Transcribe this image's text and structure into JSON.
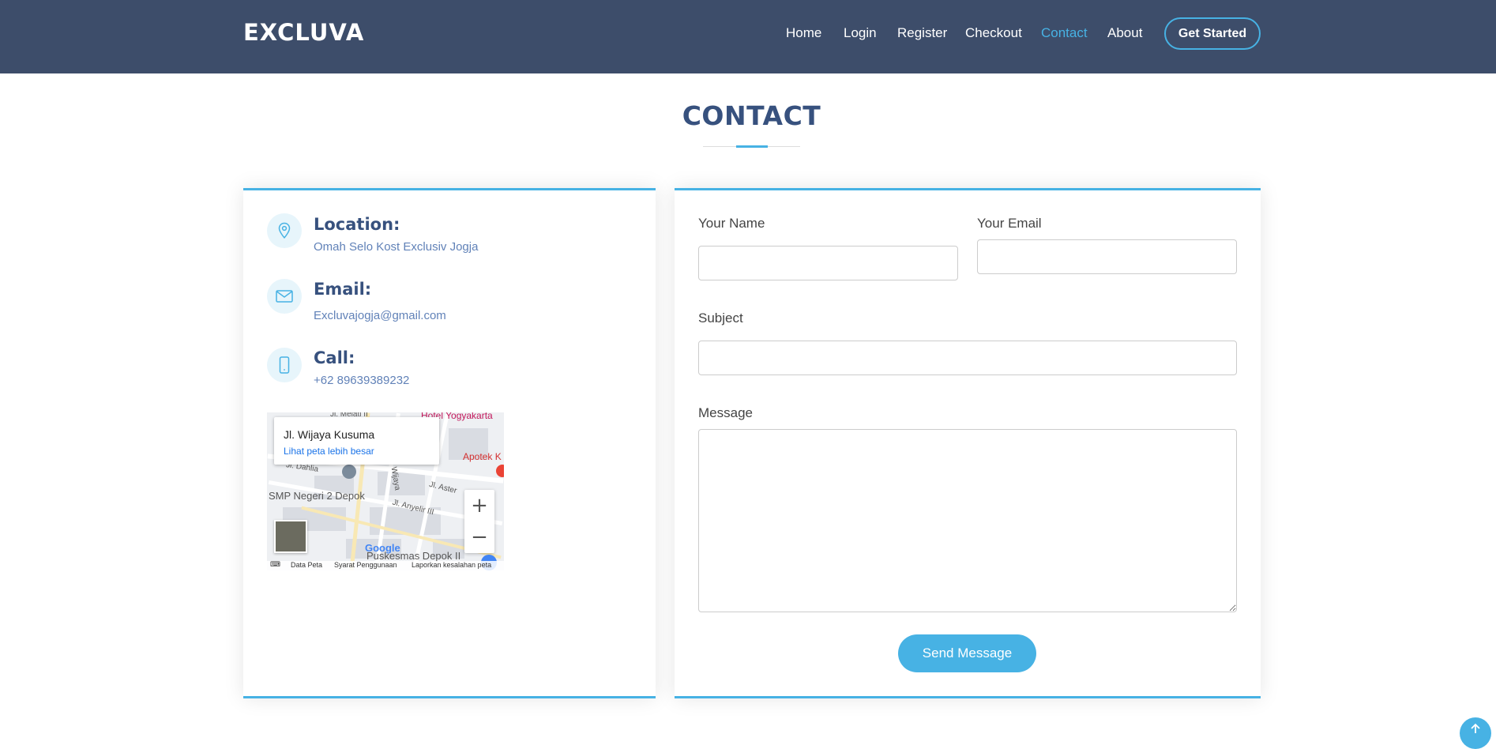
{
  "header": {
    "logo": "EXCLUVA",
    "nav": [
      "Home",
      "Login",
      "Register",
      "Checkout",
      "Contact",
      "About"
    ],
    "active_nav": "Contact",
    "cta": "Get Started"
  },
  "section": {
    "title": "CONTACT"
  },
  "info": {
    "location": {
      "heading": "Location:",
      "text": "Omah Selo Kost Exclusiv Jogja",
      "icon": "map-pin-icon"
    },
    "email": {
      "heading": "Email:",
      "text": "Excluvajogja@gmail.com",
      "icon": "envelope-icon"
    },
    "call": {
      "heading": "Call:",
      "text": "+62 89639389232",
      "icon": "phone-icon"
    }
  },
  "map": {
    "popup_title": "Jl. Wijaya Kusuma",
    "popup_link": "Lihat peta lebih besar",
    "labels": {
      "hotel": "Hotel Yogyakarta",
      "melati": "Jl. Melati II",
      "apotek": "Apotek K",
      "dahlia": "Jl. Dahlia",
      "smp": "SMP Negeri 2 Depok",
      "aster": "Jl. Aster",
      "anyelir": "Jl. Anyelir III",
      "wijaya": "Jl. Wijaya",
      "puskesmas": "Puskesmas Depok II",
      "google": "Google"
    },
    "footer": [
      "Data Peta",
      "Syarat Penggunaan",
      "Laporkan kesalahan peta"
    ],
    "zoom_in": "+",
    "zoom_out": "−"
  },
  "form": {
    "name_label": "Your Name",
    "email_label": "Your Email",
    "subject_label": "Subject",
    "message_label": "Message",
    "name_value": "",
    "email_value": "",
    "subject_value": "",
    "message_value": "",
    "submit": "Send Message"
  },
  "colors": {
    "header_bg": "#3d4d6a",
    "accent": "#47b2e4",
    "heading": "#37517e",
    "link_text": "#6182b8"
  }
}
